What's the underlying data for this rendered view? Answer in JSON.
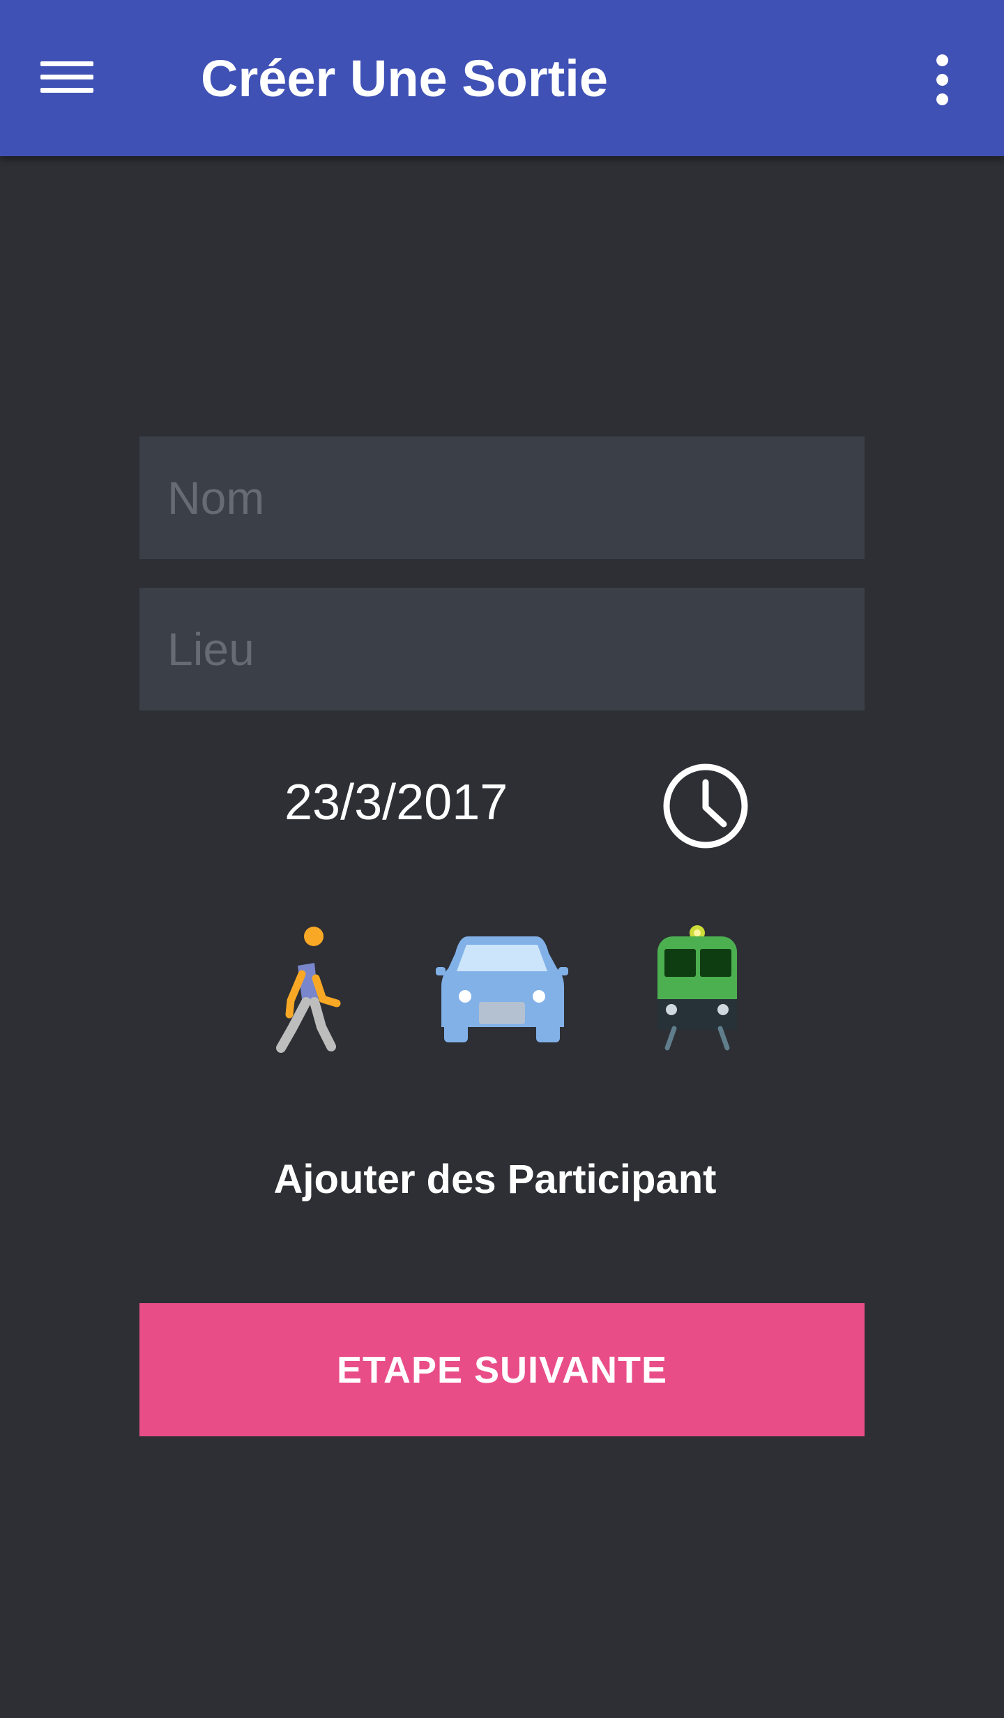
{
  "app_bar": {
    "title": "Créer Une Sortie",
    "background_color": "#3f51b5",
    "menu_icon": "menu-icon",
    "overflow_icon": "more-vert-icon"
  },
  "form": {
    "name_field": {
      "value": "",
      "placeholder": "Nom"
    },
    "place_field": {
      "value": "",
      "placeholder": "Lieu"
    },
    "date": "23/3/2017",
    "time_icon": "clock-icon",
    "transport_modes": [
      {
        "icon": "walking-person-icon"
      },
      {
        "icon": "car-icon"
      },
      {
        "icon": "train-icon"
      }
    ],
    "add_participants_label": "Ajouter des Participant",
    "next_button_label": "ETAPE SUIVANTE"
  },
  "colors": {
    "page_background": "#2d2f34",
    "field_background": "#3a3f48",
    "accent": "#e94d88"
  }
}
